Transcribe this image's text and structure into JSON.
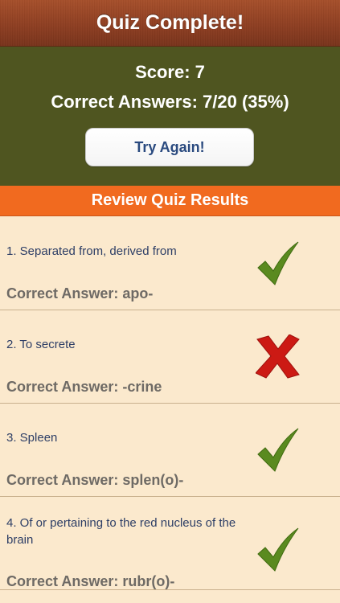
{
  "header": {
    "title": "Quiz Complete!"
  },
  "score": {
    "score_text": "Score: 7",
    "correct_text": "Correct Answers: 7/20 (35%)",
    "try_again_label": "Try Again!"
  },
  "review": {
    "title": "Review Quiz Results"
  },
  "results": [
    {
      "question": "1. Separated from, derived from",
      "answer": "Correct Answer: apo-",
      "status": "correct",
      "icon": "check-icon"
    },
    {
      "question": "2. To secrete",
      "answer": "Correct Answer: -crine",
      "status": "incorrect",
      "icon": "x-icon"
    },
    {
      "question": "3. Spleen",
      "answer": "Correct Answer: splen(o)-",
      "status": "correct",
      "icon": "check-icon"
    },
    {
      "question": "4. Of or pertaining to the red nucleus of the brain",
      "answer": "Correct Answer: rubr(o)-",
      "status": "correct",
      "icon": "check-icon"
    }
  ],
  "colors": {
    "header_brown": "#8f3f22",
    "score_panel_olive": "#4f5520",
    "review_orange": "#f16a1f",
    "list_bg_cream": "#fbe9cd",
    "check_green": "#5a8a1f",
    "x_red": "#cc1a14",
    "question_text": "#2d3e66",
    "answer_text": "#6e6a65",
    "button_text": "#2a4a7f"
  }
}
